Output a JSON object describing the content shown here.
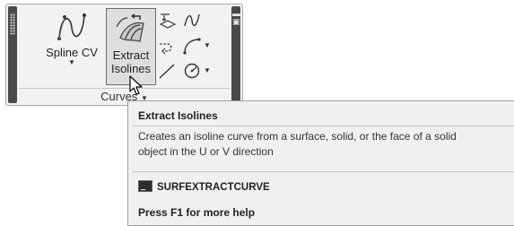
{
  "ribbon_panel": {
    "title": "Curves",
    "tools": {
      "spline_cv": {
        "label": "Spline CV",
        "icon": "spline-cv-icon"
      },
      "extract_isolines": {
        "label_line1": "Extract",
        "label_line2": "Isolines",
        "icon": "extract-isolines-icon"
      }
    },
    "small_tools": [
      {
        "icon": "project-geometry-icon"
      },
      {
        "icon": "blend-curve-icon"
      },
      {
        "icon": "offset-curve-icon"
      },
      {
        "icon": "fillet-arc-icon"
      },
      {
        "icon": "line-icon"
      },
      {
        "icon": "circle-icon"
      }
    ]
  },
  "tooltip": {
    "title": "Extract Isolines",
    "description_line1": "Creates an isoline curve from a surface, solid, or the face of a solid",
    "description_line2": "object in the U or V direction",
    "command": "SURFEXTRACTCURVE",
    "help": "Press F1 for more help"
  },
  "colors": {
    "panel_bg": "#f2f2f2",
    "grip": "#4a4a4a",
    "tooltip_bg": "#f0f0f0"
  }
}
